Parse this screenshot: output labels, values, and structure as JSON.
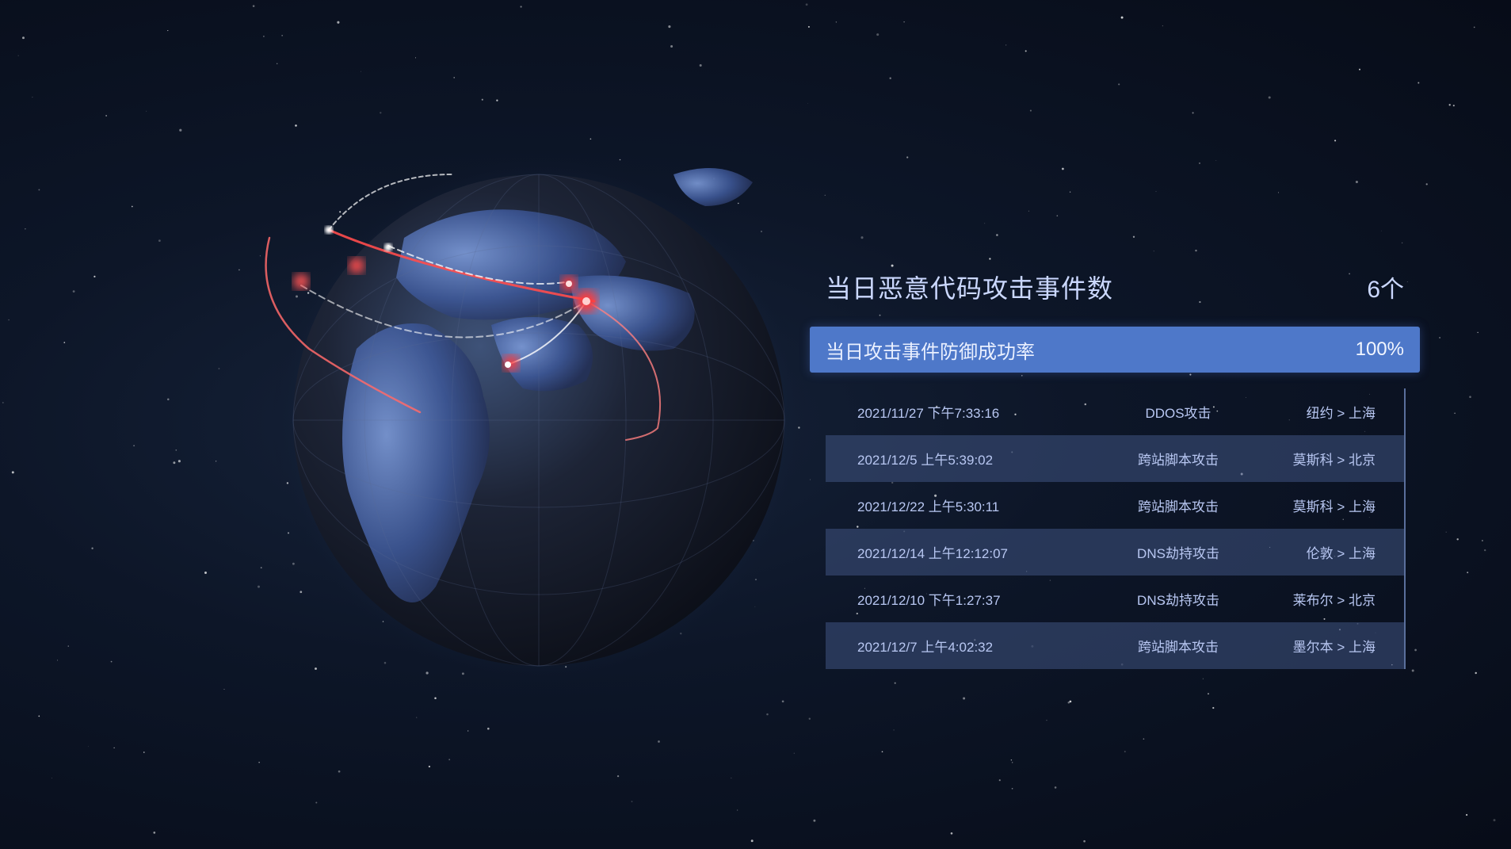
{
  "summary": {
    "title": "当日恶意代码攻击事件数",
    "value": "6个"
  },
  "rate": {
    "label": "当日攻击事件防御成功率",
    "value": "100%"
  },
  "events": [
    {
      "time": "2021/11/27 下午7:33:16",
      "type": "DDOS攻击",
      "route": "纽约 > 上海"
    },
    {
      "time": "2021/12/5 上午5:39:02",
      "type": "跨站脚本攻击",
      "route": "莫斯科 > 北京"
    },
    {
      "time": "2021/12/22 上午5:30:11",
      "type": "跨站脚本攻击",
      "route": "莫斯科 > 上海"
    },
    {
      "time": "2021/12/14 上午12:12:07",
      "type": "DNS劫持攻击",
      "route": "伦敦 > 上海"
    },
    {
      "time": "2021/12/10 下午1:27:37",
      "type": "DNS劫持攻击",
      "route": "莱布尔 > 北京"
    },
    {
      "time": "2021/12/7 上午4:02:32",
      "type": "跨站脚本攻击",
      "route": "墨尔本 > 上海"
    }
  ],
  "icons": {
    "globe": "earth-globe-icon"
  },
  "colors": {
    "background": "#0b1220",
    "rate_bar": "#4e78c9",
    "attack_red": "#ff3b3b",
    "text": "#c6d4ff"
  }
}
